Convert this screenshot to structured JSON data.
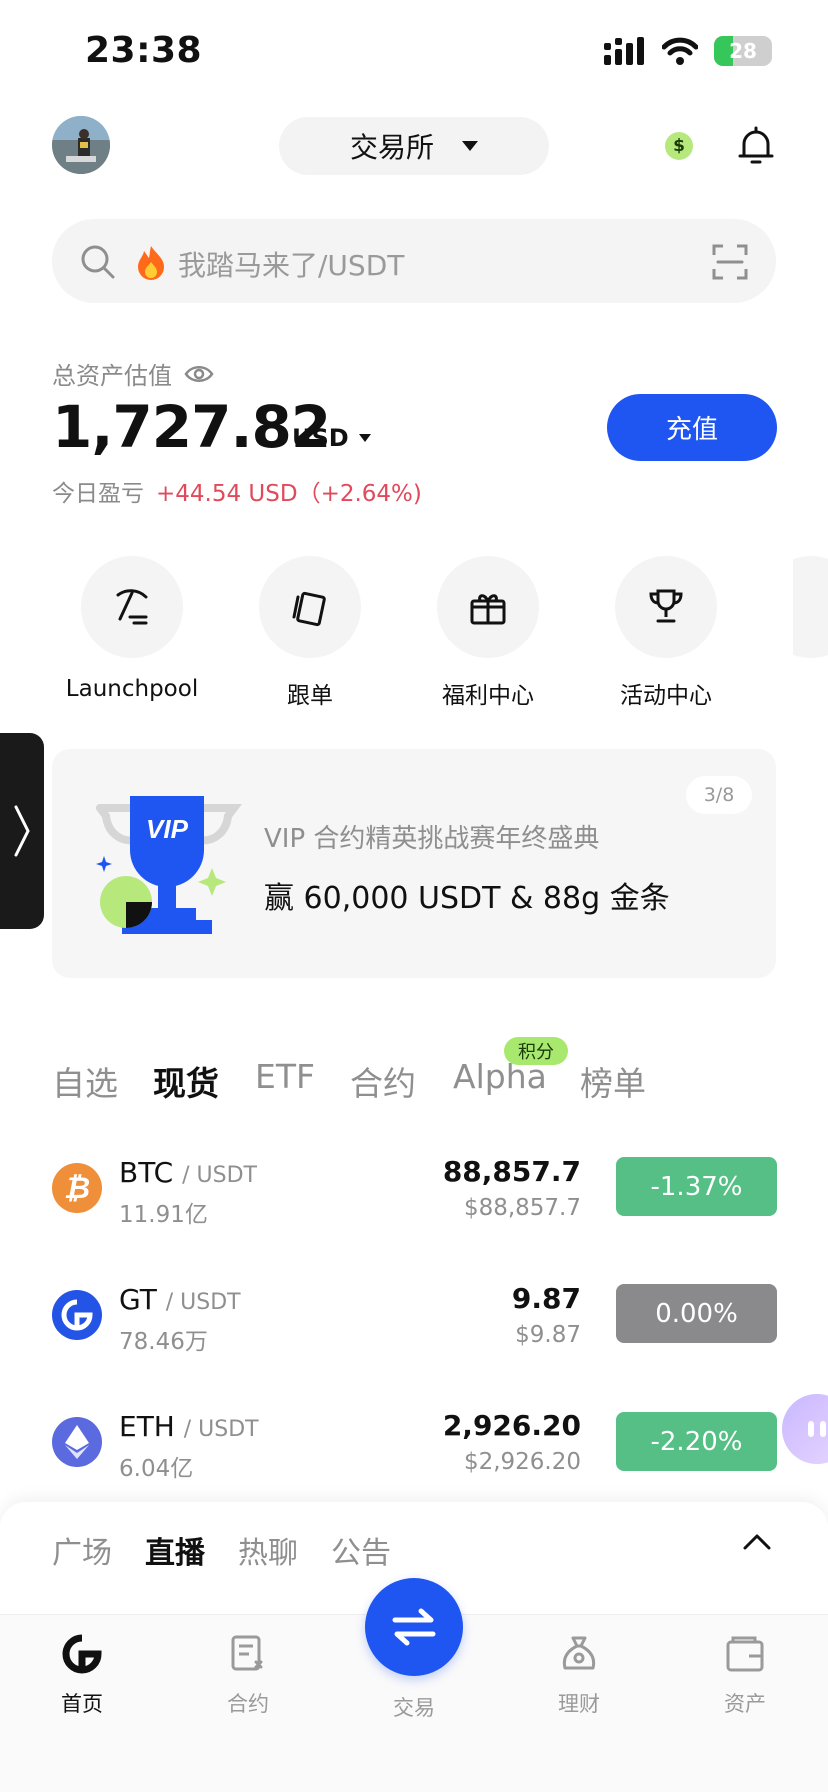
{
  "status_bar": {
    "time": "23:38",
    "battery": "28"
  },
  "header": {
    "exchange_label": "交易所"
  },
  "search": {
    "placeholder": "我踏马来了/USDT"
  },
  "assets": {
    "label": "总资产估值",
    "value": "1,727.82",
    "unit": "USD",
    "pnl_label": "今日盈亏",
    "pnl_value": "+44.54 USD（+2.64%)",
    "deposit_label": "充值"
  },
  "shortcuts": [
    {
      "label": "Launchpool",
      "icon": "pickaxe-icon"
    },
    {
      "label": "跟单",
      "icon": "cards-icon"
    },
    {
      "label": "福利中心",
      "icon": "gift-icon"
    },
    {
      "label": "活动中心",
      "icon": "trophy-icon"
    }
  ],
  "banner": {
    "counter": "3/8",
    "title": "VIP 合约精英挑战赛年终盛典",
    "subtitle": "赢 60,000 USDT & 88g 金条",
    "badge_text": "VIP"
  },
  "market_tabs": [
    "自选",
    "现货",
    "ETF",
    "合约",
    "Alpha",
    "榜单"
  ],
  "market_tabs_active": "现货",
  "alpha_badge": "积分",
  "markets": [
    {
      "base": "BTC",
      "quote": "/ USDT",
      "volume": "11.91亿",
      "price": "88,857.7",
      "fiat": "$88,857.7",
      "change": "-1.37%",
      "change_color": "#55bf86"
    },
    {
      "base": "GT",
      "quote": "/ USDT",
      "volume": "78.46万",
      "price": "9.87",
      "fiat": "$9.87",
      "change": "0.00%",
      "change_color": "#8a8a8c"
    },
    {
      "base": "ETH",
      "quote": "/ USDT",
      "volume": "6.04亿",
      "price": "2,926.20",
      "fiat": "$2,926.20",
      "change": "-2.20%",
      "change_color": "#55bf86"
    }
  ],
  "feed_tabs": [
    "广场",
    "直播",
    "热聊",
    "公告"
  ],
  "feed_tabs_active": "直播",
  "nav": [
    {
      "label": "首页",
      "icon": "home-logo-icon",
      "active": true
    },
    {
      "label": "合约",
      "icon": "contract-icon"
    },
    {
      "label": "交易",
      "icon": "swap-icon"
    },
    {
      "label": "理财",
      "icon": "money-bag-icon"
    },
    {
      "label": "资产",
      "icon": "wallet-icon"
    }
  ],
  "colors": {
    "accent": "#1f55f1",
    "up": "#e04a5a",
    "down": "#55bf86",
    "neutral": "#8a8a8c"
  }
}
